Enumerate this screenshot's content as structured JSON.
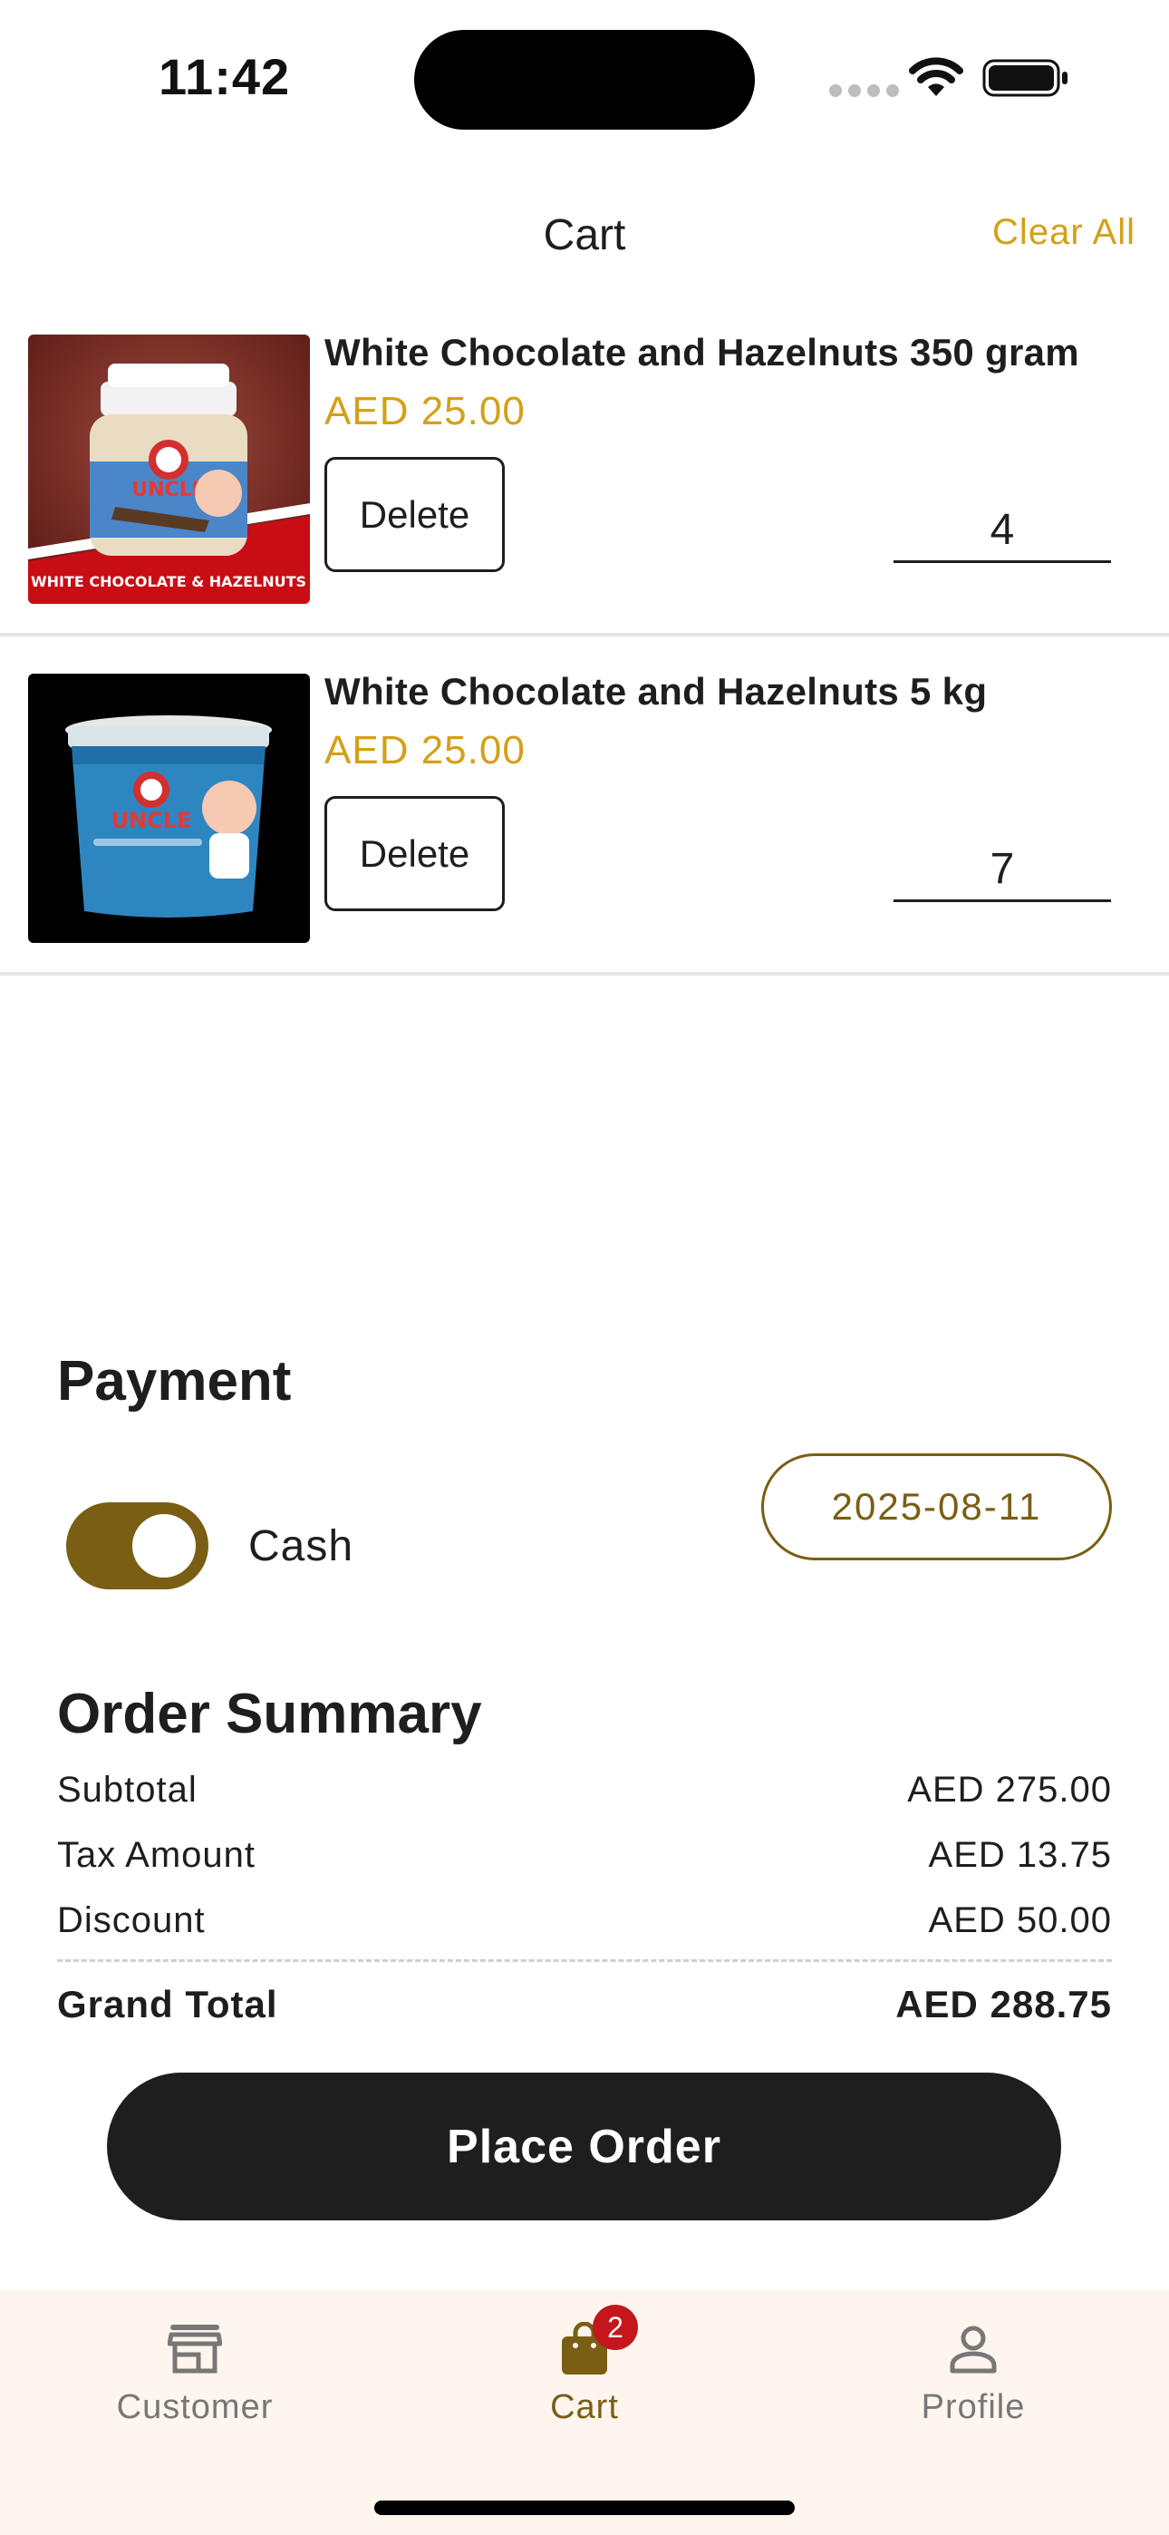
{
  "status_bar": {
    "time": "11:42"
  },
  "header": {
    "title": "Cart",
    "clear_all_label": "Clear All"
  },
  "cart_items": [
    {
      "name": "White Chocolate and Hazelnuts 350 gram",
      "price": "AED 25.00",
      "delete_label": "Delete",
      "quantity": "4",
      "image_caption": "WHITE CHOCOLATE & HAZELNUTS",
      "image_brand": "UNCLE"
    },
    {
      "name": "White Chocolate and Hazelnuts 5 kg",
      "price": "AED 25.00",
      "delete_label": "Delete",
      "quantity": "7",
      "image_brand": "UNCLE"
    }
  ],
  "payment": {
    "heading": "Payment",
    "method_label": "Cash",
    "method_enabled": true,
    "date": "2025-08-11"
  },
  "order_summary": {
    "heading": "Order Summary",
    "rows": [
      {
        "label": "Subtotal",
        "value": "AED 275.00"
      },
      {
        "label": "Tax Amount",
        "value": "AED 13.75"
      },
      {
        "label": "Discount",
        "value": "AED 50.00"
      }
    ],
    "grand_total": {
      "label": "Grand Total",
      "value": "AED 288.75"
    }
  },
  "place_order_label": "Place Order",
  "bottom_nav": {
    "items": [
      {
        "label": "Customer",
        "icon": "store-icon"
      },
      {
        "label": "Cart",
        "icon": "shopping-bag-icon",
        "badge": "2",
        "active": true
      },
      {
        "label": "Profile",
        "icon": "person-icon"
      }
    ]
  },
  "colors": {
    "accent": "#d4a017",
    "brand": "#7a5e14",
    "badge": "#c4161c",
    "button": "#1e1e1e",
    "nav_background": "#fdf5ee"
  }
}
